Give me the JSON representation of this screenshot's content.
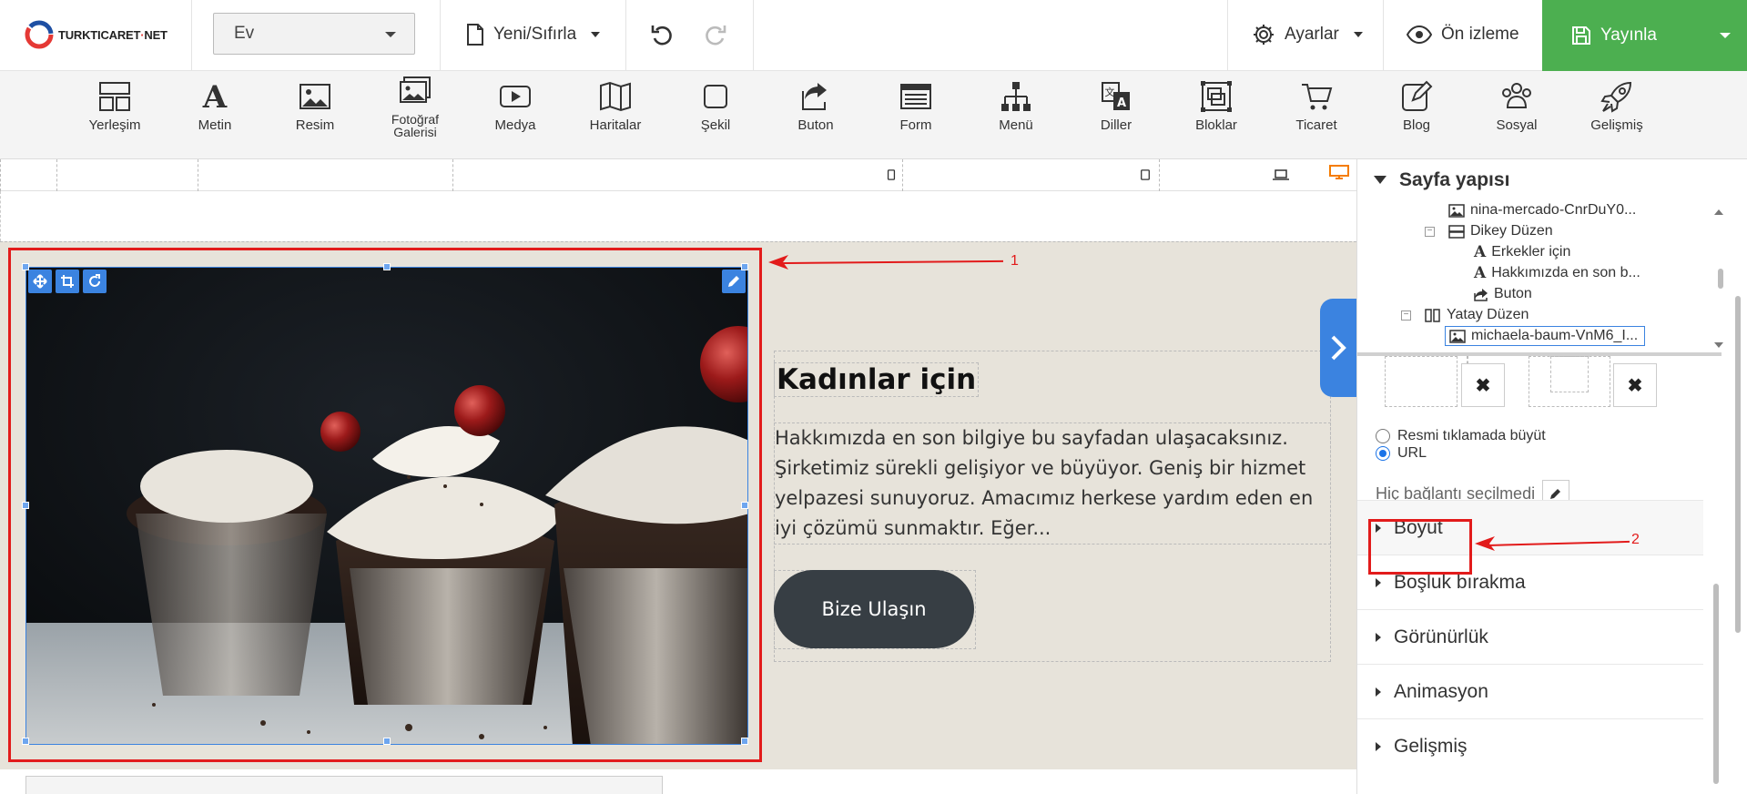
{
  "header": {
    "logo_text_main": "TURKTICARET",
    "logo_text_suffix": "NET",
    "page_select_value": "Ev",
    "new_reset_label": "Yeni/Sıfırla",
    "settings_label": "Ayarlar",
    "preview_label": "Ön izleme",
    "publish_label": "Yayınla"
  },
  "toolbar": {
    "items": [
      {
        "label": "Yerleşim",
        "icon": "layout-icon"
      },
      {
        "label": "Metin",
        "icon": "text-icon"
      },
      {
        "label": "Resim",
        "icon": "image-icon"
      },
      {
        "label": "Fotoğraf Galerisi",
        "icon": "gallery-icon"
      },
      {
        "label": "Medya",
        "icon": "media-icon"
      },
      {
        "label": "Haritalar",
        "icon": "map-icon"
      },
      {
        "label": "Şekil",
        "icon": "shape-icon"
      },
      {
        "label": "Buton",
        "icon": "button-icon"
      },
      {
        "label": "Form",
        "icon": "form-icon"
      },
      {
        "label": "Menü",
        "icon": "menu-icon"
      },
      {
        "label": "Diller",
        "icon": "languages-icon"
      },
      {
        "label": "Bloklar",
        "icon": "blocks-icon"
      },
      {
        "label": "Ticaret",
        "icon": "cart-icon"
      },
      {
        "label": "Blog",
        "icon": "blog-icon"
      },
      {
        "label": "Sosyal",
        "icon": "social-icon"
      },
      {
        "label": "Gelişmiş",
        "icon": "rocket-icon"
      }
    ]
  },
  "content": {
    "heading": "Kadınlar için",
    "paragraph": "Hakkımızda en son bilgiye bu sayfadan ulaşacaksınız. Şirketimiz sürekli gelişiyor ve büyüyor. Geniş bir hizmet yelpazesi sunuyoruz. Amacımız herkese yardım eden en iyi çözümü sunmaktır. Eğer...",
    "cta_label": "Bize Ulaşın"
  },
  "annotations": {
    "one": "1",
    "two": "2"
  },
  "panel": {
    "title": "Sayfa yapısı",
    "tree": [
      {
        "label": "nina-mercado-CnrDuY0...",
        "icon": "image-icon"
      },
      {
        "label": "Dikey Düzen",
        "icon": "vertical-layout-icon"
      },
      {
        "label": "Erkekler için",
        "icon": "text-icon"
      },
      {
        "label": "Hakkımızda en son b...",
        "icon": "text-icon"
      },
      {
        "label": "Buton",
        "icon": "button-icon"
      },
      {
        "label": "Yatay Düzen",
        "icon": "horizontal-layout-icon"
      },
      {
        "label": "michaela-baum-VnM6_I...",
        "icon": "image-icon"
      }
    ],
    "radio_enlarge": "Resmi tıklamada büyüt",
    "radio_url": "URL",
    "radio_selected": "URL",
    "link_text": "Hiç bağlantı seçilmedi",
    "sections": [
      "Boyut",
      "Boşluk bırakma",
      "Görünürlük",
      "Animasyon",
      "Gelişmiş"
    ]
  },
  "colors": {
    "accent": "#3b83e0",
    "publish": "#4caf50",
    "annotation": "#e21b1b",
    "section_bg": "#e7e3da",
    "button_dark": "#373e44"
  }
}
